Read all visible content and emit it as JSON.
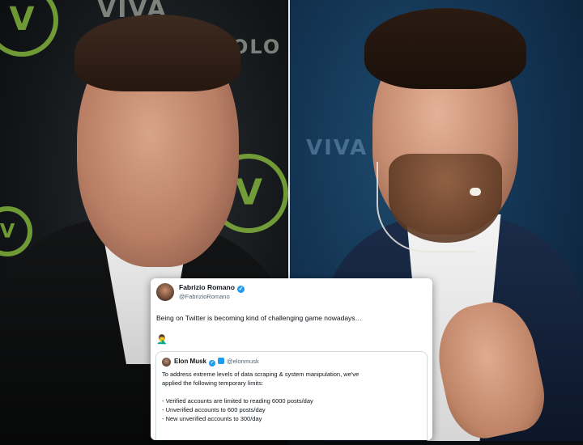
{
  "background": {
    "left_banner_top": "VIVA",
    "left_banner_side": "OLO",
    "right_sign": "VIVA"
  },
  "tweet": {
    "author_name": "Fabrizio Romano",
    "author_handle": "@FabrizioRomano",
    "verified_glyph": "✓",
    "text": "Being on Twitter is becoming kind of challenging game nowadays…",
    "emoji": "🤦‍♂️",
    "quote": {
      "author_name": "Elon Musk",
      "author_handle": "@elonmusk",
      "verified_glyph": "✓",
      "lines": [
        "To address extreme levels of data scraping & system manipulation, we've",
        "applied the following temporary limits:",
        "",
        "- Verified accounts are limited to reading 6000 posts/day",
        "- Unverified accounts to 600 posts/day",
        "- New unverified accounts to 300/day"
      ]
    }
  },
  "colors": {
    "verified_blue": "#1d9bf0",
    "logo_green": "#8ec63f"
  }
}
